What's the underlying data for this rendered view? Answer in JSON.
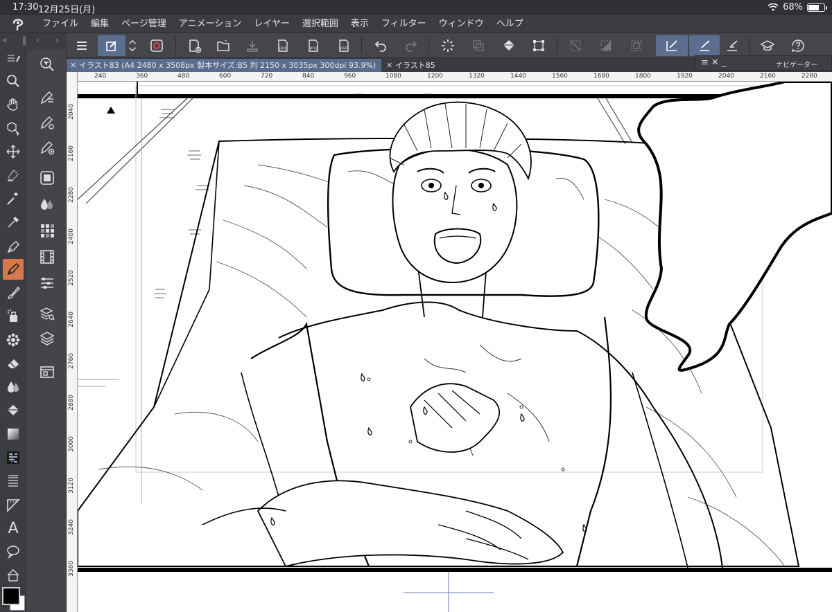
{
  "status": {
    "time": "17:30",
    "date": "12月25日(月)",
    "battery_text": "68%",
    "battery_level": 0.68
  },
  "menu": [
    "ファイル",
    "編集",
    "ページ管理",
    "アニメーション",
    "レイヤー",
    "選択範囲",
    "表示",
    "フィルター",
    "ウィンドウ",
    "ヘルプ"
  ],
  "tabs": [
    {
      "label": "イラスト83 (A4 2480 x 3508px 製本サイズ:B5 判 2150 x 3035px 300dpi 93.9%)",
      "active": true
    },
    {
      "label": "イラスト85",
      "active": false
    }
  ],
  "navigator": {
    "title": "ナビゲーター"
  },
  "ruler": {
    "h_labels": [
      "240",
      "360",
      "480",
      "600",
      "720",
      "840",
      "960",
      "1080",
      "1200",
      "1320",
      "1440",
      "1560",
      "1680",
      "1800",
      "1920",
      "2040",
      "2160",
      "2280"
    ],
    "v_labels": [
      "2040",
      "2160",
      "2280",
      "2400",
      "2520",
      "2640",
      "2760",
      "2880",
      "3000",
      "3120",
      "3240",
      "3360"
    ]
  },
  "colors": {
    "accent_active": "#5b6e8f",
    "tool_active": "#d8774a",
    "foreground": "#000000",
    "background": "#ffffff"
  },
  "commands": [
    "menu-icon",
    "new-layer-icon",
    "chevron-updown-icon",
    "lasso-mark-icon",
    "new-page-icon",
    "open-folder-icon",
    "save-icon",
    "export-jpg-icon",
    "export-png-icon",
    "export-psd-icon",
    "undo-icon",
    "redo-icon",
    "loading-icon",
    "layer-transform-icon",
    "fill-icon",
    "transform-icon",
    "deselect-icon",
    "invert-selection-icon",
    "selection-border-icon",
    "pen-stroke-icon",
    "brush-stroke-icon",
    "ruler-stroke-icon",
    "learn-icon",
    "help-icon"
  ],
  "cmd_labels": {
    "jpg": "jpg",
    "png": "png",
    "psd": "psd"
  },
  "tools": [
    "zoom-icon",
    "hand-icon",
    "object-icon",
    "move-icon",
    "select-icon",
    "magic-wand-icon",
    "eyedropper-icon",
    "pen-icon",
    "pencil-icon",
    "brush-icon",
    "airbrush-icon",
    "decoration-icon",
    "eraser-icon",
    "blend-icon",
    "fill-icon",
    "gradient-icon",
    "figure-icon",
    "frame-icon",
    "ruler-icon",
    "text-icon",
    "balloon-icon",
    "correction-icon"
  ],
  "text_tool_glyph": "A"
}
